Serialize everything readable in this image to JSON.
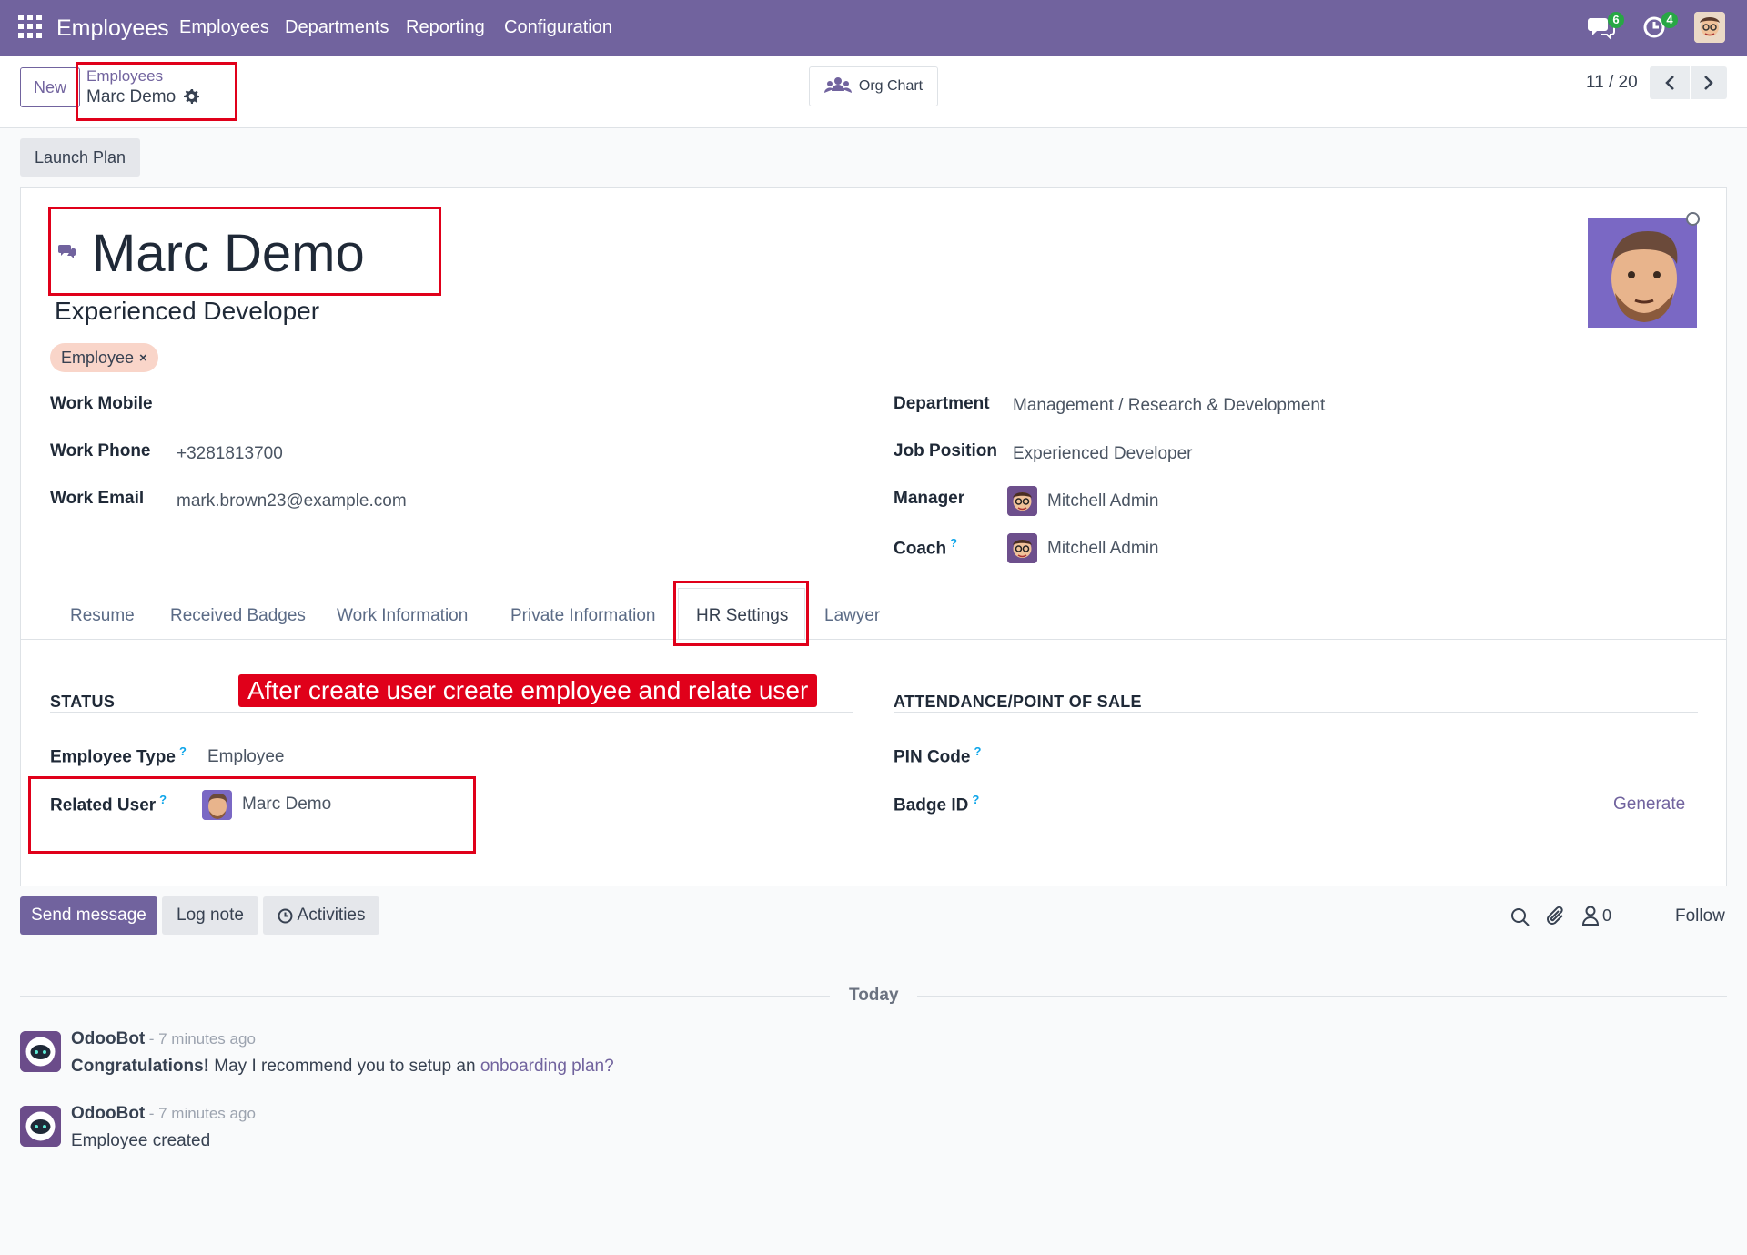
{
  "navbar": {
    "app_title": "Employees",
    "menu": [
      "Employees",
      "Departments",
      "Reporting",
      "Configuration"
    ],
    "messages_badge": "6",
    "activities_badge": "4",
    "color": "#71639e"
  },
  "control_panel": {
    "new_label": "New",
    "breadcrumb_parent": "Employees",
    "breadcrumb_current": "Marc Demo",
    "org_chart_label": "Org Chart",
    "pager": "11 / 20"
  },
  "launch_plan_label": "Launch Plan",
  "employee": {
    "name": "Marc Demo",
    "job_title": "Experienced Developer",
    "tag": "Employee",
    "left_fields": [
      {
        "label": "Work Mobile",
        "value": ""
      },
      {
        "label": "Work Phone",
        "value": "+3281813700"
      },
      {
        "label": "Work Email",
        "value": "mark.brown23@example.com"
      }
    ],
    "department_label": "Department",
    "department": "Management / Research & Development",
    "job_position_label": "Job Position",
    "job_position": "Experienced Developer",
    "manager_label": "Manager",
    "manager": "Mitchell Admin",
    "coach_label": "Coach",
    "coach": "Mitchell Admin"
  },
  "tabs": [
    "Resume",
    "Received Badges",
    "Work Information",
    "Private Information",
    "HR Settings",
    "Lawyer"
  ],
  "active_tab": "HR Settings",
  "hr_settings": {
    "status_heading": "STATUS",
    "annotation": "After create user create employee and relate user",
    "employee_type_label": "Employee Type",
    "employee_type": "Employee",
    "related_user_label": "Related User",
    "related_user": "Marc Demo",
    "attendance_heading": "ATTENDANCE/POINT OF SALE",
    "pin_label": "PIN Code",
    "badge_label": "Badge ID",
    "generate_label": "Generate"
  },
  "chatter": {
    "send_message": "Send message",
    "log_note": "Log note",
    "activities": "Activities",
    "followers_count": "0",
    "follow": "Follow",
    "date_separator": "Today",
    "messages": [
      {
        "author": "OdooBot",
        "time": "- 7 minutes ago",
        "bold": "Congratulations!",
        "text": " May I recommend you to setup an ",
        "link": "onboarding plan?"
      },
      {
        "author": "OdooBot",
        "time": "- 7 minutes ago",
        "text": "Employee created"
      }
    ]
  }
}
